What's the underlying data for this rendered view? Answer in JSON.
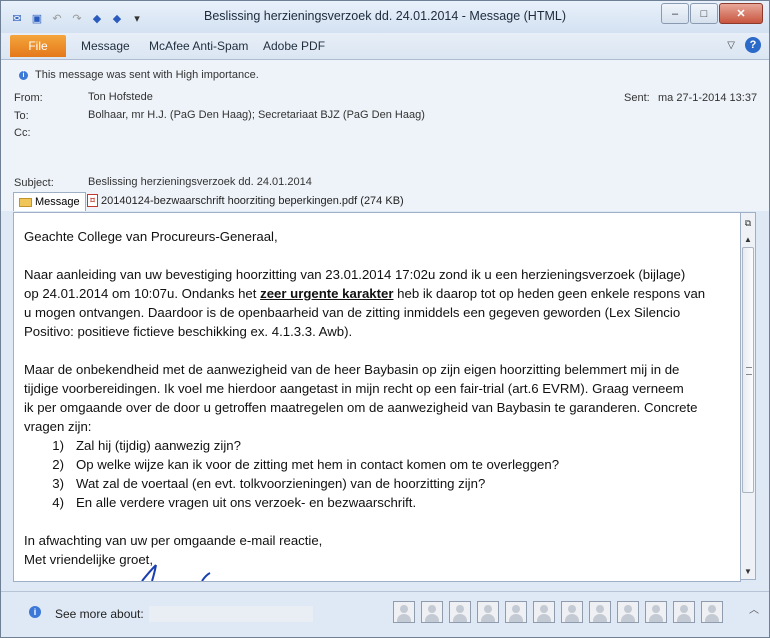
{
  "window": {
    "title": "Beslissing herzieningsverzoek dd. 24.01.2014  -  Message (HTML)"
  },
  "ribbon": {
    "file_label": "File",
    "tabs": [
      "Message",
      "McAfee Anti-Spam",
      "Adobe PDF"
    ]
  },
  "header": {
    "importance_notice": "This message was sent with High importance.",
    "from_label": "From:",
    "from_value": "Ton Hofstede",
    "to_label": "To:",
    "to_value": "Bolhaar, mr H.J. (PaG Den Haag); Secretariaat BJZ (PaG Den Haag)",
    "cc_label": "Cc:",
    "sent_label": "Sent:",
    "sent_value": "ma 27-1-2014 13:37",
    "subject_label": "Subject:",
    "subject_value": "Beslissing herzieningsverzoek dd. 24.01.2014"
  },
  "attachments": {
    "message_tab": "Message",
    "file": "20140124-bezwaarschrift hoorziting beperkingen.pdf (274 KB)"
  },
  "body": {
    "greeting": "Geachte College van Procureurs-Generaal,",
    "p1_a": "Naar aanleiding van uw bevestiging hoorzitting van 23.01.2014 17:02u zond ik u een herzieningsverzoek (bijlage)",
    "p1_b_pre": "op  24.01.2014 om 10:07u. Ondanks het ",
    "p1_b_em": "zeer urgente karakter",
    "p1_b_post": " heb ik daarop tot op heden geen enkele respons van",
    "p1_c": "u mogen ontvangen. Daardoor is de openbaarheid van de zitting inmiddels een gegeven geworden (Lex Silencio",
    "p1_d": "Positivo: positieve fictieve beschikking ex. 4.1.3.3. Awb).",
    "p2_a": "Maar de onbekendheid met de aanwezigheid van de heer Baybasin op zijn eigen hoorzitting belemmert mij in de",
    "p2_b": "tijdige voorbereidingen. Ik voel me hierdoor aangetast in mijn recht op een fair-trial (art.6 EVRM). Graag verneem",
    "p2_c": "ik per omgaande over de door u getroffen maatregelen om de aanwezigheid van Baybasin te garanderen. Concrete",
    "p2_d": "vragen zijn:",
    "list": [
      {
        "num": "1)",
        "text": "Zal hij (tijdig) aanwezig zijn?"
      },
      {
        "num": "2)",
        "text": "Op welke wijze kan ik voor de zitting met hem in contact komen om te overleggen?"
      },
      {
        "num": "3)",
        "text": "Wat zal de voertaal (en evt. tolkvoorzieningen) van de hoorzitting zijn?"
      },
      {
        "num": "4)",
        "text": "En alle verdere vragen uit ons verzoek- en bezwaarschrift."
      }
    ],
    "closing_1": "In afwachting van uw per omgaande e-mail reactie,",
    "closing_2": "Met vriendelijke groet,"
  },
  "people_pane": {
    "see_more": "See more about:"
  },
  "colors": {
    "file_tab": "#e4781b",
    "window_bg": "#dfe9f5",
    "accent_blue": "#2c6ac9"
  }
}
